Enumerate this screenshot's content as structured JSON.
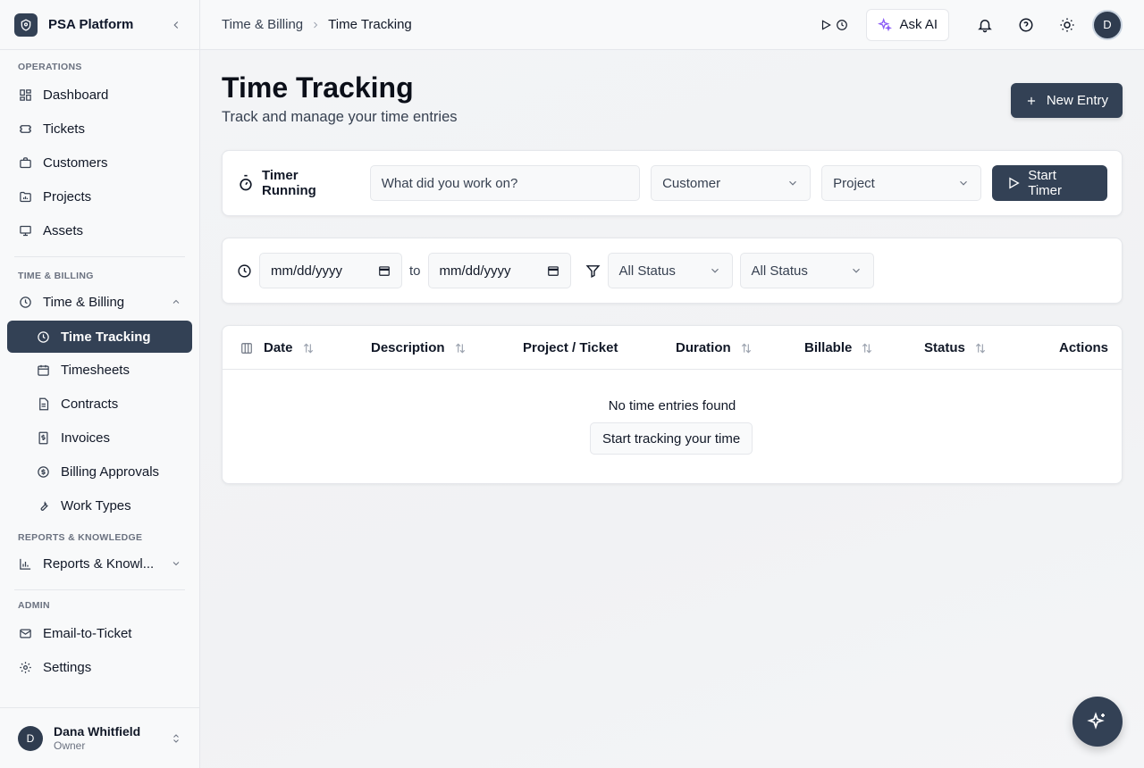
{
  "brand": {
    "name": "PSA Platform"
  },
  "sidebar": {
    "sections": {
      "operations": "OPERATIONS",
      "time_billing": "TIME & BILLING",
      "reports": "REPORTS & KNOWLEDGE",
      "admin": "ADMIN"
    },
    "items": {
      "dashboard": "Dashboard",
      "tickets": "Tickets",
      "customers": "Customers",
      "projects": "Projects",
      "assets": "Assets",
      "time_billing": "Time & Billing",
      "time_tracking": "Time Tracking",
      "timesheets": "Timesheets",
      "contracts": "Contracts",
      "invoices": "Invoices",
      "billing_approvals": "Billing Approvals",
      "work_types": "Work Types",
      "reports": "Reports & Knowl...",
      "email_to_ticket": "Email-to-Ticket",
      "settings": "Settings"
    },
    "user": {
      "initial": "D",
      "name": "Dana Whitfield",
      "role": "Owner"
    }
  },
  "topbar": {
    "breadcrumb": [
      "Time & Billing",
      "Time Tracking"
    ],
    "ask_ai": "Ask AI",
    "avatar_initial": "D"
  },
  "page": {
    "title": "Time Tracking",
    "subtitle": "Track and manage your time entries",
    "new_entry": "New Entry"
  },
  "timer": {
    "label": "Timer Running",
    "description_placeholder": "What did you work on?",
    "customer": "Customer",
    "project": "Project",
    "start": "Start Timer"
  },
  "filters": {
    "date_from": "mm/dd/yyyy",
    "to": "to",
    "date_to": "mm/dd/yyyy",
    "status_1": "All Status",
    "status_2": "All Status"
  },
  "table": {
    "columns": [
      "Date",
      "Description",
      "Project / Ticket",
      "Duration",
      "Billable",
      "Status",
      "Actions"
    ],
    "empty_text": "No time entries found",
    "empty_action": "Start tracking your time"
  },
  "colors": {
    "primary": "#334155",
    "ai_accent": "#8b5cf6"
  }
}
